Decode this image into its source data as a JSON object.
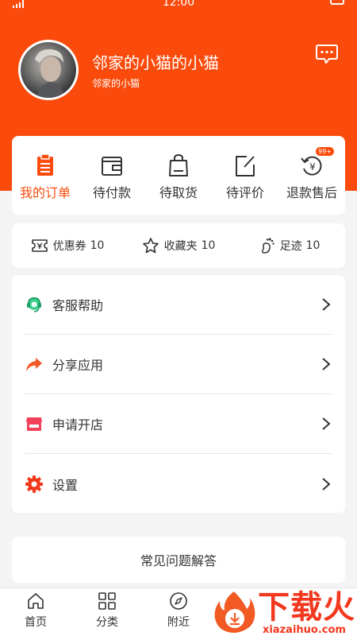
{
  "status_bar": {
    "time": "12:00"
  },
  "profile": {
    "name": "邻家的小猫的小猫",
    "subtitle": "邻家的小猫"
  },
  "orders": [
    {
      "label": "我的订单",
      "icon": "clipboard-icon",
      "active": true
    },
    {
      "label": "待付款",
      "icon": "wallet-icon"
    },
    {
      "label": "待取货",
      "icon": "shopping-bag-icon"
    },
    {
      "label": "待评价",
      "icon": "edit-icon"
    },
    {
      "label": "退款售后",
      "icon": "refund-icon",
      "badge": "99+"
    }
  ],
  "stats": [
    {
      "label": "优惠券",
      "count": "10",
      "icon": "coupon-icon"
    },
    {
      "label": "收藏夹",
      "count": "10",
      "icon": "star-icon"
    },
    {
      "label": "足迹",
      "count": "10",
      "icon": "footprint-icon"
    }
  ],
  "menu": [
    {
      "label": "客服帮助",
      "icon": "headset-icon",
      "color": "#3ecf8e"
    },
    {
      "label": "分享应用",
      "icon": "share-icon",
      "color": "#f25a24"
    },
    {
      "label": "申请开店",
      "icon": "store-icon",
      "color": "#f2405a"
    },
    {
      "label": "设置",
      "icon": "gear-icon",
      "color": "#f2381d"
    }
  ],
  "faq": {
    "label": "常见问题解答"
  },
  "tabs": [
    {
      "label": "首页",
      "icon": "home-icon"
    },
    {
      "label": "分类",
      "icon": "grid-icon"
    },
    {
      "label": "附近",
      "icon": "compass-icon"
    }
  ],
  "watermark": {
    "text": "下载火",
    "url": "xiazaihuo.com"
  },
  "colors": {
    "accent": "#fb4b0c",
    "background": "#f4f4f4"
  }
}
